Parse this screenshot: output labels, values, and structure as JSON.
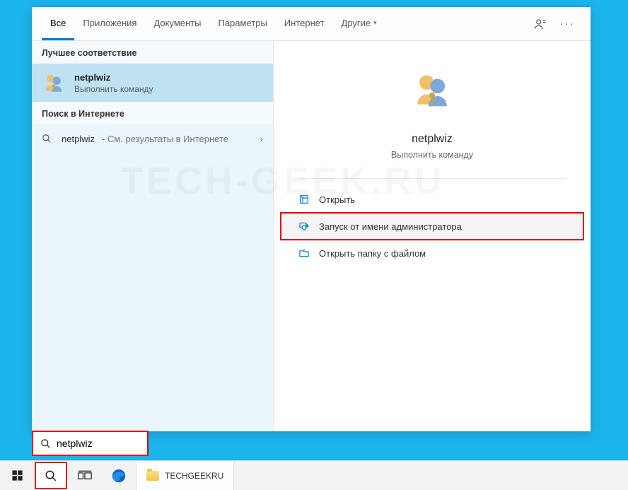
{
  "tabs": {
    "all": "Все",
    "apps": "Приложения",
    "docs": "Документы",
    "settings": "Параметры",
    "internet": "Интернет",
    "more": "Другие"
  },
  "left": {
    "best_match_header": "Лучшее соответствие",
    "best": {
      "title": "netplwiz",
      "subtitle": "Выполнить команду"
    },
    "web_header": "Поиск в Интернете",
    "web": {
      "term": "netplwiz",
      "suffix": " - См. результаты в Интернете"
    }
  },
  "right": {
    "title": "netplwiz",
    "subtitle": "Выполнить команду",
    "actions": {
      "open": "Открыть",
      "run_admin": "Запуск от имени администратора",
      "open_location": "Открыть папку с файлом"
    }
  },
  "search": {
    "value": "netplwiz"
  },
  "taskbar": {
    "app_label": "TECHGEEKRU"
  },
  "watermark": "TECH-GEEK.RU"
}
